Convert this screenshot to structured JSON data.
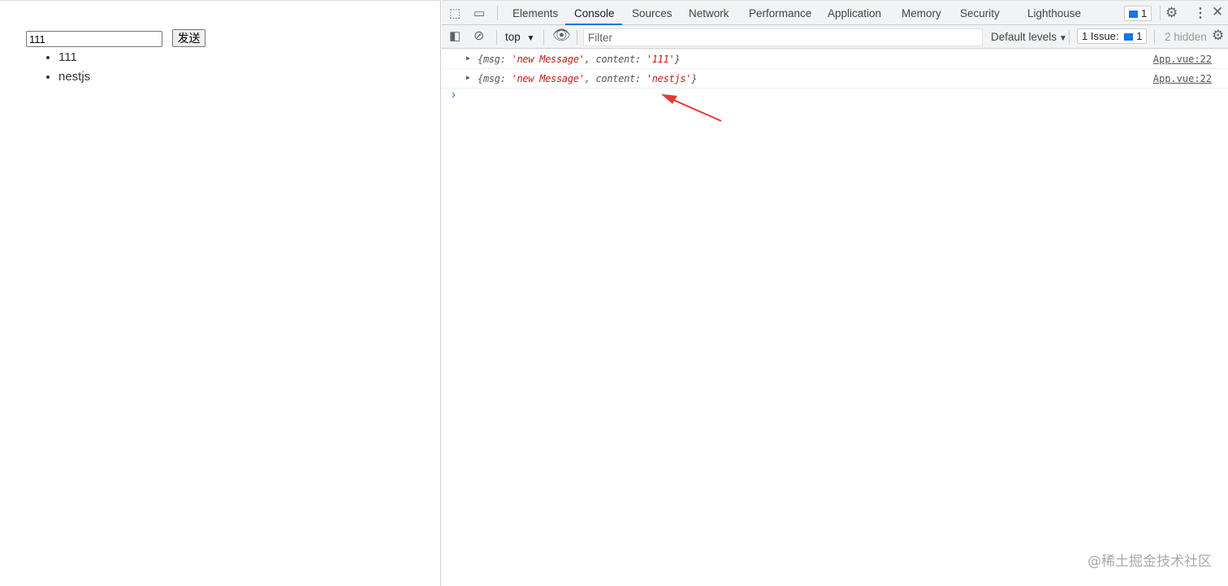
{
  "page": {
    "input_value": "111",
    "send_label": "发送",
    "messages": [
      "111",
      "nestjs"
    ]
  },
  "devtools": {
    "tabs": [
      "Elements",
      "Console",
      "Sources",
      "Network",
      "Performance",
      "Application",
      "Memory",
      "Security",
      "Lighthouse"
    ],
    "active_tab": "Console",
    "messages_badge": "1",
    "context": "top",
    "filter_placeholder": "Filter",
    "levels": "Default levels",
    "issues_label": "1 Issue:",
    "issues_count": "1",
    "hidden": "2 hidden",
    "logs": [
      {
        "msg_key": "msg",
        "msg_val": "'new Message'",
        "content_key": "content",
        "content_val": "'111'",
        "source": "App.vue:22"
      },
      {
        "msg_key": "msg",
        "msg_val": "'new Message'",
        "content_key": "content",
        "content_val": "'nestjs'",
        "source": "App.vue:22"
      }
    ],
    "prompt": "›"
  },
  "watermark": "@稀土掘金技术社区",
  "colors": {
    "accent": "#1a73e8",
    "string": "#c41a16",
    "arrow": "#e53935"
  }
}
